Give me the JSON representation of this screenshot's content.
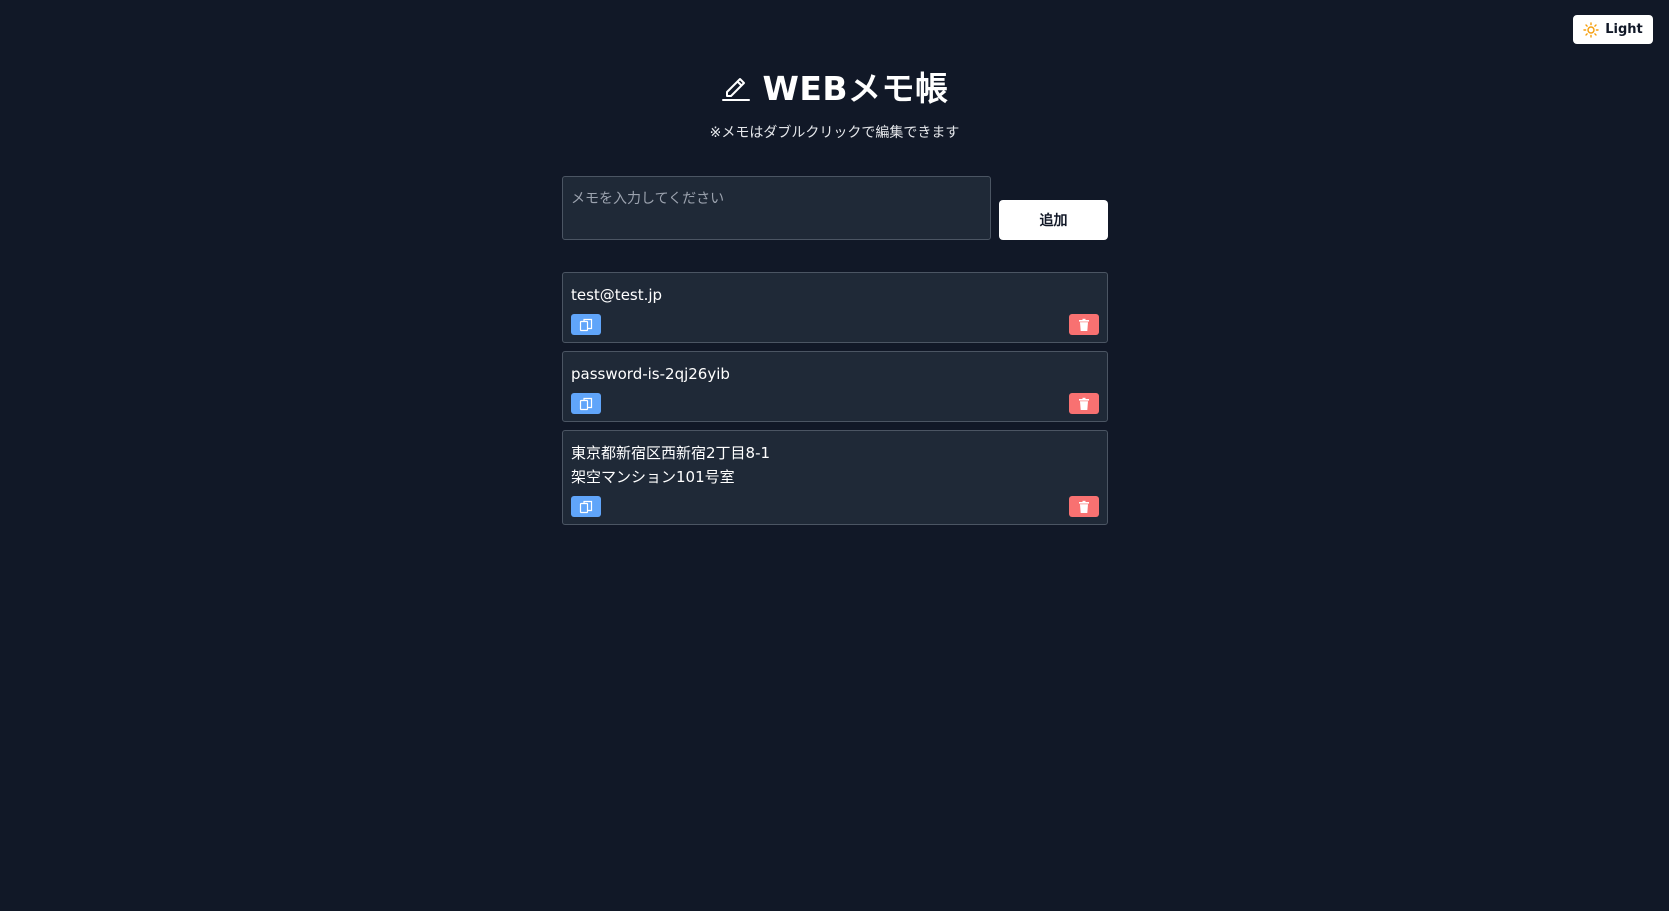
{
  "theme_toggle": {
    "icon": "sun-icon",
    "label": "Light",
    "icon_color": "#f59e0b"
  },
  "header": {
    "icon": "pencil-icon",
    "title": "WEBメモ帳",
    "subtitle": "※メモはダブルクリックで編集できます"
  },
  "composer": {
    "placeholder": "メモを入力してください",
    "value": "",
    "add_label": "追加"
  },
  "memos": [
    {
      "text": "test@test.jp",
      "copy_icon": "copy-icon",
      "delete_icon": "trash-icon"
    },
    {
      "text": "password-is-2qj26yib",
      "copy_icon": "copy-icon",
      "delete_icon": "trash-icon"
    },
    {
      "text": "東京都新宿区西新宿2丁目8-1\n架空マンション101号室",
      "copy_icon": "copy-icon",
      "delete_icon": "trash-icon"
    }
  ],
  "colors": {
    "background": "#111827",
    "card": "#1f2937",
    "copy_button": "#60a5fa",
    "delete_button": "#f87171"
  }
}
